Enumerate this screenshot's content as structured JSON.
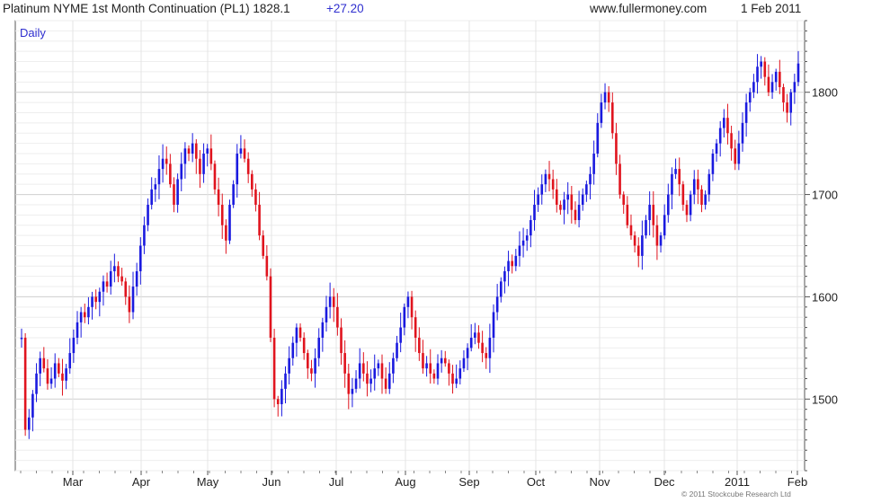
{
  "header": {
    "title": "Platinum NYME 1st Month Continuation (PL1) 1828.1",
    "change": "+27.20",
    "site": "www.fullermoney.com",
    "date": "1 Feb 2011"
  },
  "footer": {
    "copyright": "© 2011 Stockcube Research Ltd"
  },
  "colors": {
    "up": "#1a1adf",
    "down": "#e0141e",
    "grid": "#cfcfcf",
    "accent": "#2f2fcf"
  },
  "chart_data": {
    "type": "line",
    "title": "Platinum NYME 1st Month Continuation (PL1) 1828.1",
    "period_label": "Daily",
    "ylim": [
      1430,
      1870
    ],
    "yticks": [
      1500,
      1600,
      1700,
      1800
    ],
    "xlabels": [
      "Mar",
      "Apr",
      "May",
      "Jun",
      "Jul",
      "Aug",
      "Sep",
      "Oct",
      "Nov",
      "Dec",
      "2011",
      "Feb"
    ],
    "grid": true,
    "legend": "none",
    "series": [
      {
        "values": [
          1560,
          1470,
          1482,
          1505,
          1525,
          1540,
          1530,
          1515,
          1520,
          1535,
          1525,
          1518,
          1530,
          1545,
          1560,
          1575,
          1585,
          1580,
          1590,
          1600,
          1595,
          1605,
          1615,
          1610,
          1625,
          1630,
          1620,
          1615,
          1600,
          1585,
          1610,
          1625,
          1650,
          1670,
          1690,
          1705,
          1710,
          1725,
          1735,
          1730,
          1710,
          1690,
          1715,
          1730,
          1745,
          1740,
          1750,
          1735,
          1720,
          1740,
          1745,
          1730,
          1705,
          1690,
          1670,
          1655,
          1690,
          1710,
          1740,
          1745,
          1735,
          1720,
          1705,
          1690,
          1660,
          1640,
          1620,
          1560,
          1500,
          1495,
          1510,
          1525,
          1540,
          1555,
          1570,
          1560,
          1545,
          1530,
          1525,
          1540,
          1560,
          1575,
          1590,
          1600,
          1590,
          1570,
          1545,
          1525,
          1505,
          1510,
          1520,
          1535,
          1525,
          1515,
          1520,
          1530,
          1535,
          1520,
          1510,
          1525,
          1540,
          1555,
          1570,
          1590,
          1600,
          1580,
          1560,
          1545,
          1530,
          1535,
          1525,
          1520,
          1535,
          1540,
          1535,
          1525,
          1515,
          1520,
          1530,
          1540,
          1550,
          1560,
          1565,
          1555,
          1545,
          1540,
          1560,
          1585,
          1600,
          1615,
          1625,
          1635,
          1630,
          1640,
          1650,
          1655,
          1660,
          1675,
          1690,
          1700,
          1710,
          1720,
          1715,
          1705,
          1690,
          1685,
          1695,
          1700,
          1685,
          1675,
          1690,
          1700,
          1710,
          1720,
          1740,
          1770,
          1790,
          1800,
          1790,
          1760,
          1730,
          1700,
          1690,
          1670,
          1660,
          1650,
          1640,
          1660,
          1675,
          1690,
          1670,
          1650,
          1660,
          1680,
          1700,
          1720,
          1725,
          1710,
          1690,
          1680,
          1700,
          1715,
          1705,
          1690,
          1700,
          1720,
          1740,
          1750,
          1765,
          1775,
          1760,
          1745,
          1730,
          1750,
          1770,
          1790,
          1800,
          1810,
          1825,
          1830,
          1815,
          1800,
          1810,
          1820,
          1805,
          1790,
          1780,
          1800,
          1810,
          1828.1
        ]
      }
    ]
  }
}
